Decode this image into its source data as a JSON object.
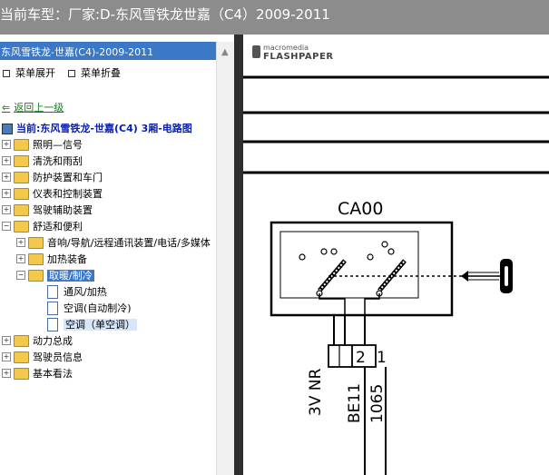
{
  "window": {
    "title": "当前车型：厂家:D-东风雪铁龙世嘉（C4）2009-2011"
  },
  "left_pane": {
    "header": "东风雪铁龙-世嘉(C4)-2009-2011",
    "expand_all": "菜单展开",
    "collapse_all": "菜单折叠",
    "back": "返回上一级",
    "current": "当前:东风雪铁龙-世嘉(C4) 3厢-电路图",
    "tree": {
      "lighting": "照明—信号",
      "wash_wipe": "清洗和雨刮",
      "protection_doors": "防护装置和车门",
      "instruments": "仪表和控制装置",
      "driving_aids": "驾驶辅助装置",
      "comfort": "舒适和便利",
      "audio_nav": "音响/导航/远程通讯装置/电话/多媒体",
      "heating_equip": "加热装备",
      "heating_cooling": "取暖/制冷",
      "ventilation_heating": "通风/加热",
      "ac_auto": "空调(自动制冷)",
      "ac_single": "空调（单空调）",
      "powertrain": "动力总成",
      "driver_info": "驾驶员信息",
      "basic": "基本看法"
    }
  },
  "viewer": {
    "logo_top": "macromedia",
    "logo_bottom": "FLASHPAPER",
    "connector": "CA00",
    "pins": [
      "2",
      "1"
    ],
    "wire_left": "3V NR",
    "wire_mid": "BE11",
    "wire_right": "1065"
  }
}
